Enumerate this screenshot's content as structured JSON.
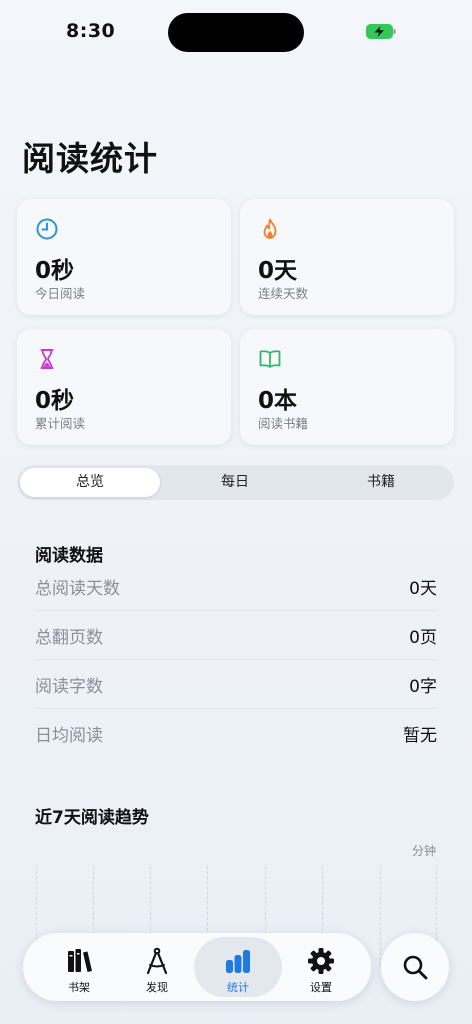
{
  "status": {
    "time": "8:30"
  },
  "page": {
    "title": "阅读统计"
  },
  "cards": [
    {
      "value": "0秒",
      "label": "今日阅读",
      "icon": "clock-icon",
      "color": "#2a95d9"
    },
    {
      "value": "0天",
      "label": "连续天数",
      "icon": "flame-icon",
      "color": "#f0832a"
    },
    {
      "value": "0秒",
      "label": "累计阅读",
      "icon": "hourglass-icon",
      "color": "#c43bd2"
    },
    {
      "value": "0本",
      "label": "阅读书籍",
      "icon": "book-open-icon",
      "color": "#33b86a"
    }
  ],
  "segments": [
    "总览",
    "每日",
    "书籍"
  ],
  "selected_segment": "总览",
  "reading_data": {
    "title": "阅读数据",
    "rows": [
      {
        "label": "总阅读天数",
        "value": "0天"
      },
      {
        "label": "总翻页数",
        "value": "0页"
      },
      {
        "label": "阅读字数",
        "value": "0字"
      },
      {
        "label": "日均阅读",
        "value": "暂无"
      }
    ]
  },
  "trend": {
    "title": "近7天阅读趋势",
    "unit": "分钟"
  },
  "tabbar": {
    "tabs": [
      {
        "label": "书架",
        "icon": "bookshelf-icon"
      },
      {
        "label": "发现",
        "icon": "compass-icon"
      },
      {
        "label": "统计",
        "icon": "bar-chart-icon"
      },
      {
        "label": "设置",
        "icon": "gear-icon"
      }
    ],
    "active": "统计",
    "active_color": "#1f7ae0",
    "search_icon": "search-icon"
  }
}
